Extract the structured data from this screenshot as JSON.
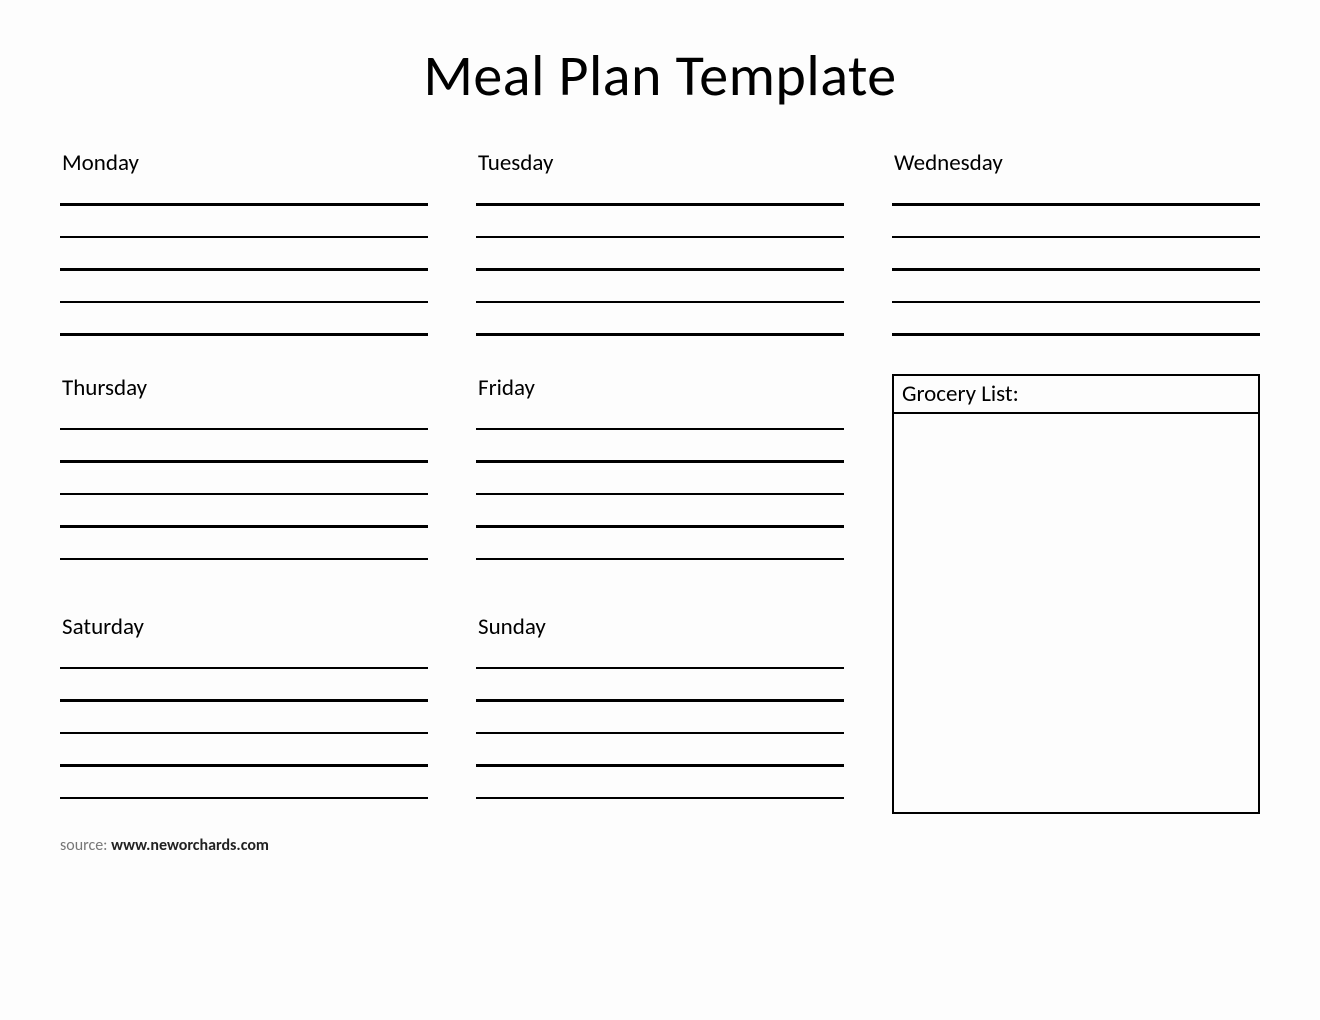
{
  "title": "Meal Plan Template",
  "days": {
    "monday": "Monday",
    "tuesday": "Tuesday",
    "wednesday": "Wednesday",
    "thursday": "Thursday",
    "friday": "Friday",
    "saturday": "Saturday",
    "sunday": "Sunday"
  },
  "grocery_label": "Grocery List:",
  "source_prefix": "source: ",
  "source_url": "www.neworchards.com"
}
